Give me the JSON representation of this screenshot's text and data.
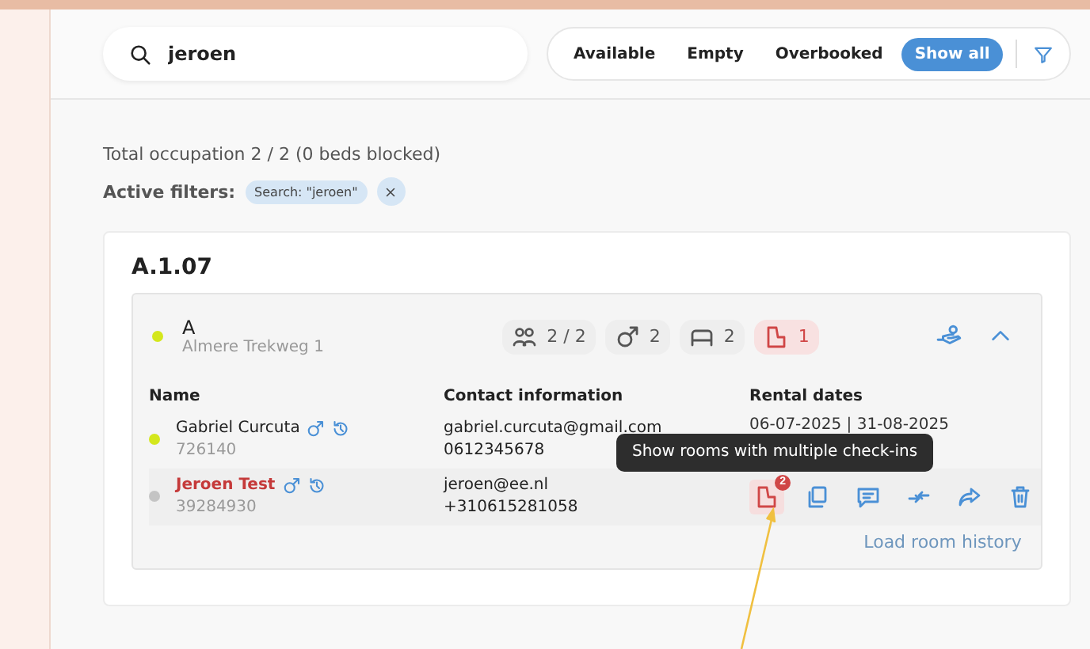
{
  "search": {
    "value": "jeroen"
  },
  "filters": [
    {
      "label": "Available",
      "selected": false
    },
    {
      "label": "Empty",
      "selected": false
    },
    {
      "label": "Overbooked",
      "selected": false
    },
    {
      "label": "Show all",
      "selected": true
    }
  ],
  "summary": "Total occupation 2 / 2 (0 beds blocked)",
  "active_filters": {
    "label": "Active filters:",
    "chips": [
      "Search: \"jeroen\""
    ]
  },
  "room": {
    "title": "A.1.07",
    "unit": {
      "name": "A",
      "address": "Almere Trekweg 1",
      "color": "#d4e71c",
      "expanded": true,
      "stats": [
        {
          "kind": "occupants",
          "value": "2 / 2",
          "alert": false
        },
        {
          "kind": "male",
          "value": "2",
          "alert": false
        },
        {
          "kind": "beds",
          "value": "2",
          "alert": false
        },
        {
          "kind": "checkins",
          "value": "1",
          "alert": true
        }
      ],
      "columns": [
        "Name",
        "Contact information",
        "Rental dates"
      ],
      "residents": [
        {
          "name": "Gabriel Curcuta",
          "id": "726140",
          "color": "#d4e71c",
          "flagged": false,
          "email": "gabriel.curcuta@gmail.com",
          "phone": "0612345678",
          "dates": "06-07-2025 | 31-08-2025"
        },
        {
          "name": "Jeroen Test",
          "id": "39284930",
          "color": "#c4c4c4",
          "flagged": true,
          "email": "jeroen@ee.nl",
          "phone": "+310615281058",
          "actions": [
            {
              "kind": "checkins",
              "badge": "2"
            },
            {
              "kind": "copy"
            },
            {
              "kind": "message"
            },
            {
              "kind": "swap"
            },
            {
              "kind": "forward"
            },
            {
              "kind": "delete"
            }
          ]
        }
      ],
      "tooltip": "Show rooms with multiple check-ins",
      "history_link": "Load room history"
    }
  }
}
